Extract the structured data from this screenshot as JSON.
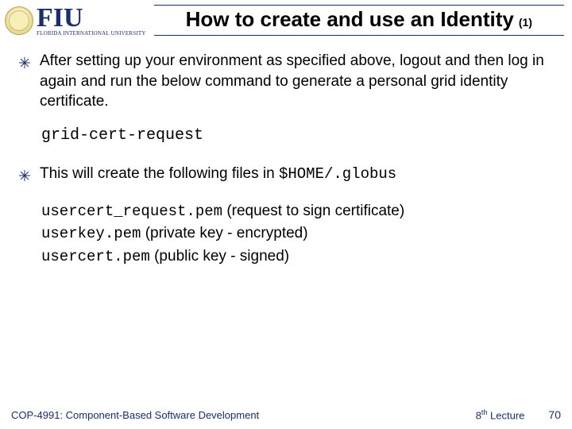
{
  "logo": {
    "text": "FIU",
    "subtext": "FLORIDA INTERNATIONAL UNIVERSITY"
  },
  "title": {
    "main": "How to create and use an Identity",
    "sub": "(1)"
  },
  "bullets": [
    {
      "text": "After setting up your environment as specified above, logout and then log in again and run the below command to generate a personal grid identity certificate."
    },
    {
      "text_pre": "This will create the following files in ",
      "code": "$HOME/.globus"
    }
  ],
  "command": "grid-cert-request",
  "files": [
    {
      "name": "usercert_request.pem",
      "desc": " (request to sign certificate)"
    },
    {
      "name": "userkey.pem",
      "desc": " (private key - encrypted)"
    },
    {
      "name": "usercert.pem",
      "desc": " (public key - signed)"
    }
  ],
  "footer": {
    "course": "COP-4991: Component-Based Software Development",
    "lecture_num": "8",
    "lecture_suffix": "th",
    "lecture_label": " Lecture",
    "page": "70"
  }
}
